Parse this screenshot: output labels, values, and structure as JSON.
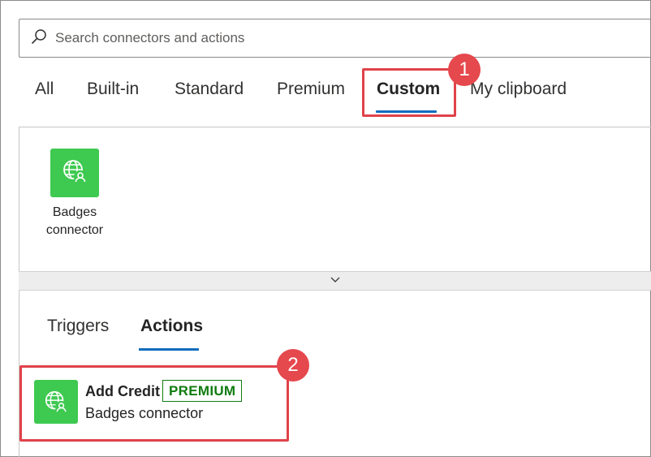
{
  "search": {
    "placeholder": "Search connectors and actions",
    "icon": "search-icon"
  },
  "tabs": [
    {
      "label": "All"
    },
    {
      "label": "Built-in"
    },
    {
      "label": "Standard"
    },
    {
      "label": "Premium"
    },
    {
      "label": "Custom",
      "active": true
    },
    {
      "label": "My clipboard"
    }
  ],
  "connectors": [
    {
      "label": "Badges connector",
      "icon": "globe-user-icon",
      "color": "#3ec950"
    }
  ],
  "expander": {
    "icon": "chevron-down-icon"
  },
  "subtabs": [
    {
      "label": "Triggers"
    },
    {
      "label": "Actions",
      "active": true
    }
  ],
  "actions": [
    {
      "title": "Add Credit",
      "badge": "PREMIUM",
      "subtitle": "Badges connector",
      "icon": "globe-user-icon"
    }
  ],
  "callouts": [
    {
      "number": "1"
    },
    {
      "number": "2"
    }
  ],
  "colors": {
    "accent": "#0f6cbd",
    "connector": "#3ec950",
    "callout": "#e0424a",
    "premium": "#107c10"
  }
}
